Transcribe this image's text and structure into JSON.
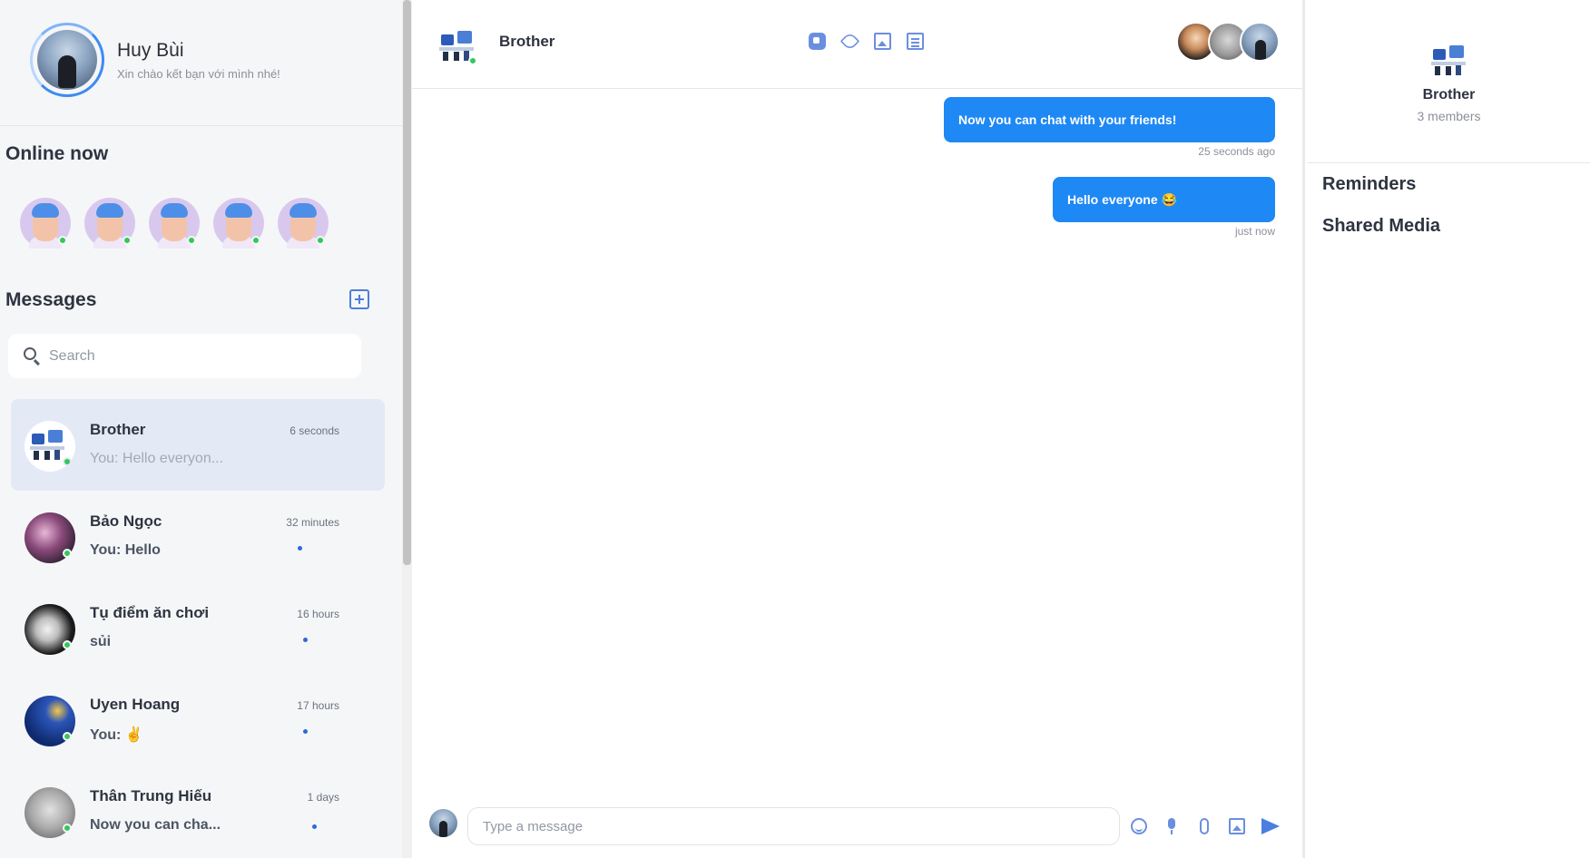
{
  "profile": {
    "name": "Huy Bùi",
    "status": "Xin chào kết bạn với mình nhé!"
  },
  "online": {
    "title": "Online now",
    "count": 5
  },
  "messages_section": {
    "title": "Messages",
    "new_chat_icon": "new-chat-icon"
  },
  "search": {
    "placeholder": "Search"
  },
  "conversations": [
    {
      "name": "Brother",
      "time": "6 seconds",
      "preview": "You: Hello everyon...",
      "active": true,
      "unread": false
    },
    {
      "name": "Bảo Ngọc",
      "time": "32 minutes",
      "preview": "You: Hello",
      "active": false,
      "unread": true
    },
    {
      "name": "Tụ điểm ăn chơi",
      "time": "16 hours",
      "preview": "sủi",
      "active": false,
      "unread": true
    },
    {
      "name": "Uyen Hoang",
      "time": "17 hours",
      "preview": "You: ✌️",
      "active": false,
      "unread": true
    },
    {
      "name": "Thân Trung Hiếu",
      "time": "1 days",
      "preview": "Now you can cha...",
      "active": false,
      "unread": true
    }
  ],
  "chat": {
    "title": "Brother",
    "header_icons": [
      "video-icon",
      "phone-icon",
      "image-icon",
      "document-icon"
    ],
    "messages": [
      {
        "text": "Now you can chat with your friends!",
        "time": "25 seconds ago"
      },
      {
        "text": "Hello everyone 😂",
        "time": "just now"
      }
    ],
    "composer_placeholder": "Type a message",
    "composer_icons": [
      "emoji-icon",
      "microphone-icon",
      "attachment-icon",
      "image-icon",
      "send-icon"
    ]
  },
  "info_panel": {
    "name": "Brother",
    "members": "3 members",
    "sections": [
      "Reminders",
      "Shared Media"
    ]
  },
  "colors": {
    "accent": "#1e88f5",
    "online": "#34c759",
    "active_conversation": "#e4e9f6",
    "icon": "#6b8fe0"
  }
}
